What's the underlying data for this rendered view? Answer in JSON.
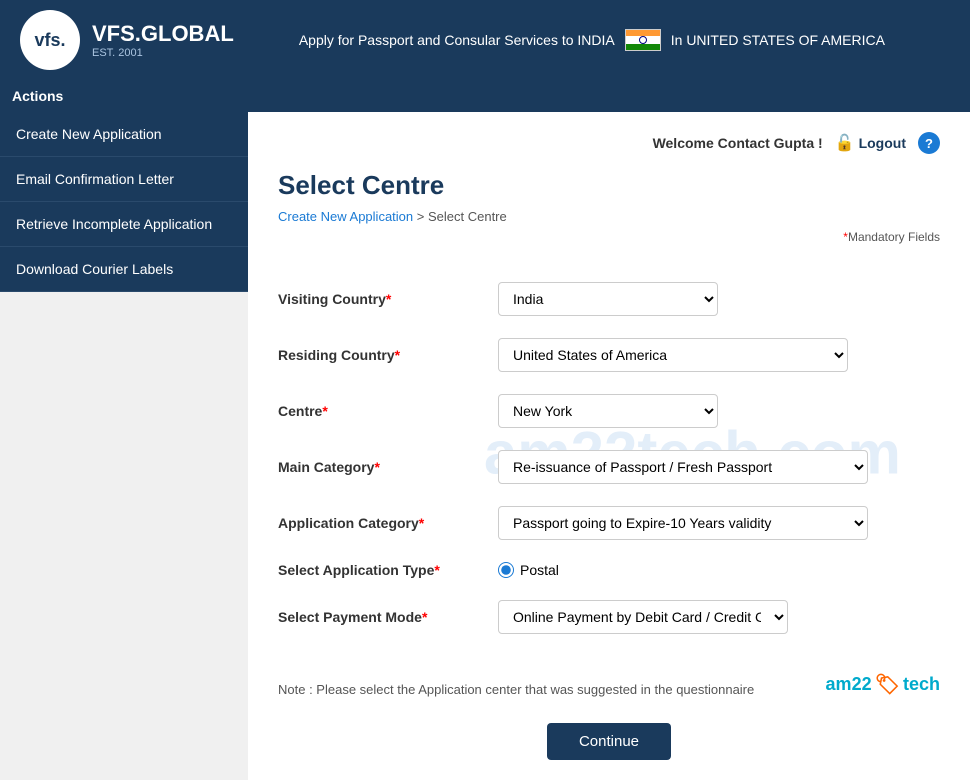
{
  "header": {
    "logo_text": "vfs.",
    "brand_name": "VFS.GLOBAL",
    "est": "EST. 2001",
    "tagline": "Apply for Passport and Consular Services to INDIA",
    "country_text": "In UNITED STATES OF AMERICA"
  },
  "actions_label": "Actions",
  "sidebar": {
    "items": [
      {
        "label": "Create New Application",
        "id": "create-new-application"
      },
      {
        "label": "Email Confirmation Letter",
        "id": "email-confirmation-letter"
      },
      {
        "label": "Retrieve Incomplete Application",
        "id": "retrieve-incomplete-application"
      },
      {
        "label": "Download Courier Labels",
        "id": "download-courier-labels"
      }
    ]
  },
  "topbar": {
    "welcome": "Welcome Contact Gupta !",
    "logout_label": "Logout",
    "help_symbol": "?"
  },
  "page": {
    "title": "Select Centre",
    "breadcrumb_parent": "Create New Application",
    "breadcrumb_separator": ">",
    "breadcrumb_current": "Select Centre",
    "mandatory_note": "*Mandatory Fields"
  },
  "form": {
    "visiting_country_label": "Visiting Country",
    "visiting_country_value": "India",
    "visiting_country_options": [
      "India"
    ],
    "residing_country_label": "Residing Country",
    "residing_country_value": "United States of America",
    "residing_country_options": [
      "United States of America"
    ],
    "centre_label": "Centre",
    "centre_value": "New York",
    "centre_options": [
      "New York"
    ],
    "main_category_label": "Main Category",
    "main_category_value": "Re-issuance of Passport / Fresh Passport",
    "main_category_options": [
      "Re-issuance of Passport / Fresh Passport"
    ],
    "app_category_label": "Application Category",
    "app_category_value": "Passport going to Expire-10 Years validity",
    "app_category_options": [
      "Passport going to Expire-10 Years validity"
    ],
    "app_type_label": "Select Application Type",
    "app_type_value": "Postal",
    "payment_mode_label": "Select Payment Mode",
    "payment_mode_value": "Online Payment by Debit Card / Credit Card",
    "payment_mode_options": [
      "Online Payment by Debit Card / Credit Card"
    ],
    "note_text": "Note : Please select the Application center that was suggested in the questionnaire",
    "continue_label": "Continue"
  },
  "watermark": "am22tech.com",
  "brand": {
    "text": "am22",
    "tag": "🏷",
    "suffix": "tech"
  }
}
